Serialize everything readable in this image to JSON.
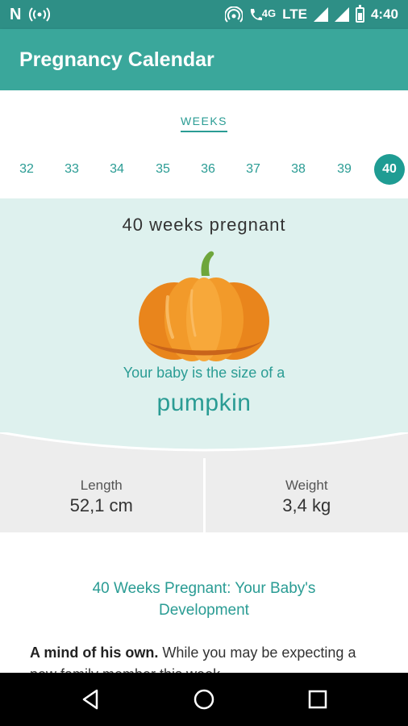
{
  "status_bar": {
    "n_label": "N",
    "lte_label": "LTE",
    "fourg_label": "4G",
    "time": "4:40"
  },
  "app_bar": {
    "title": "Pregnancy Calendar"
  },
  "tab": {
    "label": "WEEKS"
  },
  "weeks": [
    "32",
    "33",
    "34",
    "35",
    "36",
    "37",
    "38",
    "39",
    "40"
  ],
  "selected_week": "40",
  "hero": {
    "title": "40 weeks pregnant",
    "subtitle": "Your baby is the size of a",
    "fruit": "pumpkin",
    "fruit_icon": "pumpkin-icon"
  },
  "stats": {
    "length_label": "Length",
    "length_value": "52,1 cm",
    "weight_label": "Weight",
    "weight_value": "3,4 kg"
  },
  "article": {
    "title": "40 Weeks Pregnant: Your Baby's Development",
    "lead": "A mind of his own.",
    "body": " While you may be expecting a new family member this week"
  },
  "colors": {
    "status_bar": "#2e8f86",
    "app_bar": "#3aa79b",
    "accent": "#2a9c94",
    "hero_bg": "#def1ee",
    "stats_bg": "#ededed"
  },
  "nav_icons": [
    "back-icon",
    "home-icon",
    "recents-icon"
  ]
}
